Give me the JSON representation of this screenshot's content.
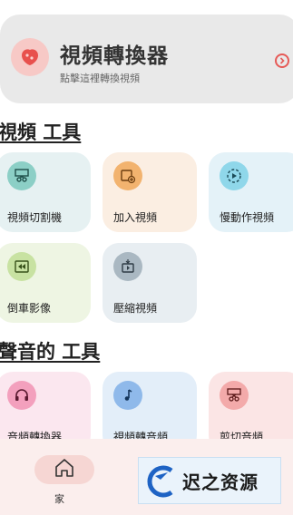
{
  "banner": {
    "title": "視頻轉換器",
    "subtitle": "點擊這裡轉換視頻"
  },
  "video_tools": {
    "title": "視頻 工具",
    "items": [
      {
        "label": "視頻切割機",
        "icon": "film-scissors-icon",
        "bg": "#e6f1f2",
        "icon_bg": "#8ccfc6"
      },
      {
        "label": "加入視頻",
        "icon": "add-video-icon",
        "bg": "#fbeee2",
        "icon_bg": "#f2b36f"
      },
      {
        "label": "慢動作視頻",
        "icon": "slow-motion-icon",
        "bg": "#e4f2f8",
        "icon_bg": "#8fd7ea"
      },
      {
        "label": "倒車影像",
        "icon": "reverse-video-icon",
        "bg": "#eef5e3",
        "icon_bg": "#c8e2a2"
      },
      {
        "label": "壓縮視頻",
        "icon": "compress-video-icon",
        "bg": "#e8eef2",
        "icon_bg": "#aab8c2"
      }
    ]
  },
  "audio_tools": {
    "title": "聲音的 工具",
    "items": [
      {
        "label": "音頻轉換器",
        "icon": "headphones-icon",
        "bg": "#fbe7ef",
        "icon_bg": "#f3a0bd"
      },
      {
        "label": "視頻轉音頻",
        "icon": "music-note-icon",
        "bg": "#e3eef9",
        "icon_bg": "#8fb9ea"
      },
      {
        "label": "剪切音頻",
        "icon": "audio-cut-icon",
        "bg": "#fbe5e5",
        "icon_bg": "#f3aaaa"
      }
    ]
  },
  "nav": {
    "home_label": "家"
  },
  "watermark": {
    "text": "迟之资源"
  },
  "colors": {
    "accent": "#e65a57",
    "nav_bg": "#fbeeed"
  }
}
